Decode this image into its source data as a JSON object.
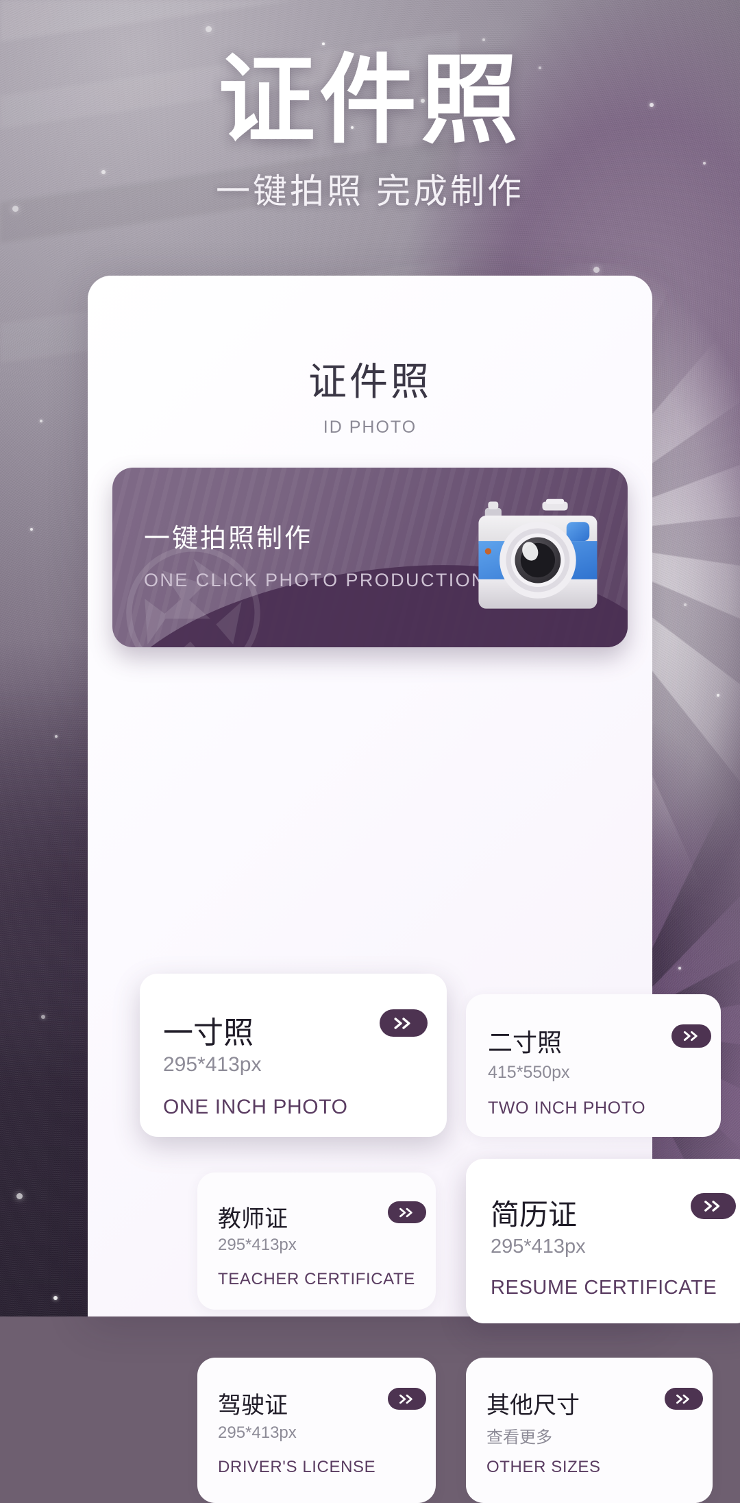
{
  "header": {
    "title": "证件照",
    "subtitle": "一键拍照 完成制作"
  },
  "panel": {
    "title": "证件照",
    "subtitle": "ID PHOTO"
  },
  "banner": {
    "title": "一键拍照制作",
    "subtitle": "ONE CLICK PHOTO PRODUCTION",
    "icon": "camera-illustration",
    "watermark": "aperture-icon"
  },
  "colors": {
    "accent_plum": "#4d3351",
    "banner_from": "#7f6a87",
    "banner_to": "#5b4263",
    "panel_bg": "#ffffff",
    "title_text": "#1f1b27",
    "size_text": "#8d8b97",
    "en_text": "#5a3c61"
  },
  "cards": [
    {
      "cn": "一寸照",
      "size": "295*413px",
      "en": "ONE INCH PHOTO",
      "arrow": "double-chevron-right-icon"
    },
    {
      "cn": "二寸照",
      "size": "415*550px",
      "en": "TWO INCH PHOTO",
      "arrow": "double-chevron-right-icon"
    },
    {
      "cn": "教师证",
      "size": "295*413px",
      "en": "TEACHER CERTIFICATE",
      "arrow": "double-chevron-right-icon"
    },
    {
      "cn": "简历证",
      "size": "295*413px",
      "en": "RESUME CERTIFICATE",
      "arrow": "double-chevron-right-icon"
    },
    {
      "cn": "驾驶证",
      "size": "295*413px",
      "en": "DRIVER'S LICENSE",
      "arrow": "double-chevron-right-icon"
    },
    {
      "cn": "其他尺寸",
      "size": "查看更多",
      "en": "OTHER SIZES",
      "arrow": "double-chevron-right-icon"
    }
  ]
}
